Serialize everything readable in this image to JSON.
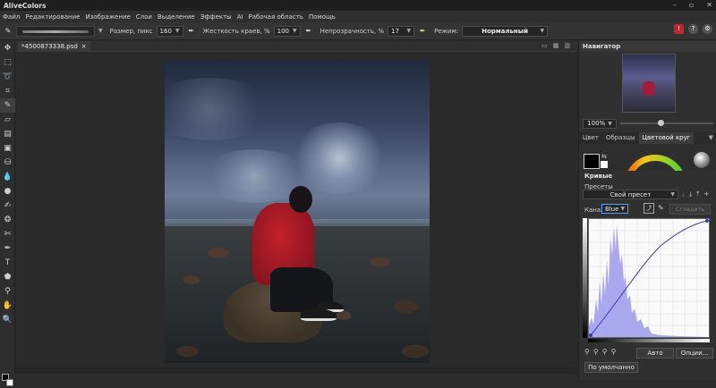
{
  "app": {
    "title": "AliveColors"
  },
  "menu": [
    "Файл",
    "Редактирование",
    "Изображение",
    "Слои",
    "Выделение",
    "Эффекты",
    "AI",
    "Рабочая область",
    "Помощь"
  ],
  "options": {
    "size_label": "Размер, пикс",
    "size_value": "160",
    "hardness_label": "Жесткость краев, %",
    "hardness_value": "100",
    "opacity_label": "Непрозрачность, %",
    "opacity_value": "17",
    "mode_label": "Режим:",
    "mode_value": "Нормальный"
  },
  "document": {
    "tab_name": "*4500873338.psd"
  },
  "navigator": {
    "title": "Навигатор",
    "zoom": "100%",
    "zoom_slider_fraction": 0.4
  },
  "color_tabs": [
    "Цвет",
    "Образцы",
    "Цветовой круг"
  ],
  "curves": {
    "title": "Кривые",
    "presets_label": "Пресеты",
    "preset_value": "Свой пресет",
    "channel_label": "Канал",
    "channel_value": "Blue",
    "smooth_label": "Сгладить",
    "auto_label": "Авто",
    "options_label": "Опции...",
    "default_label": "По умолчанно"
  },
  "colors": {
    "foreground": "#000000",
    "background": "#ffffff",
    "accent_alert": "#c0272d",
    "curve_line": "#3a3aa8",
    "histogram": "#a9a8ee"
  }
}
